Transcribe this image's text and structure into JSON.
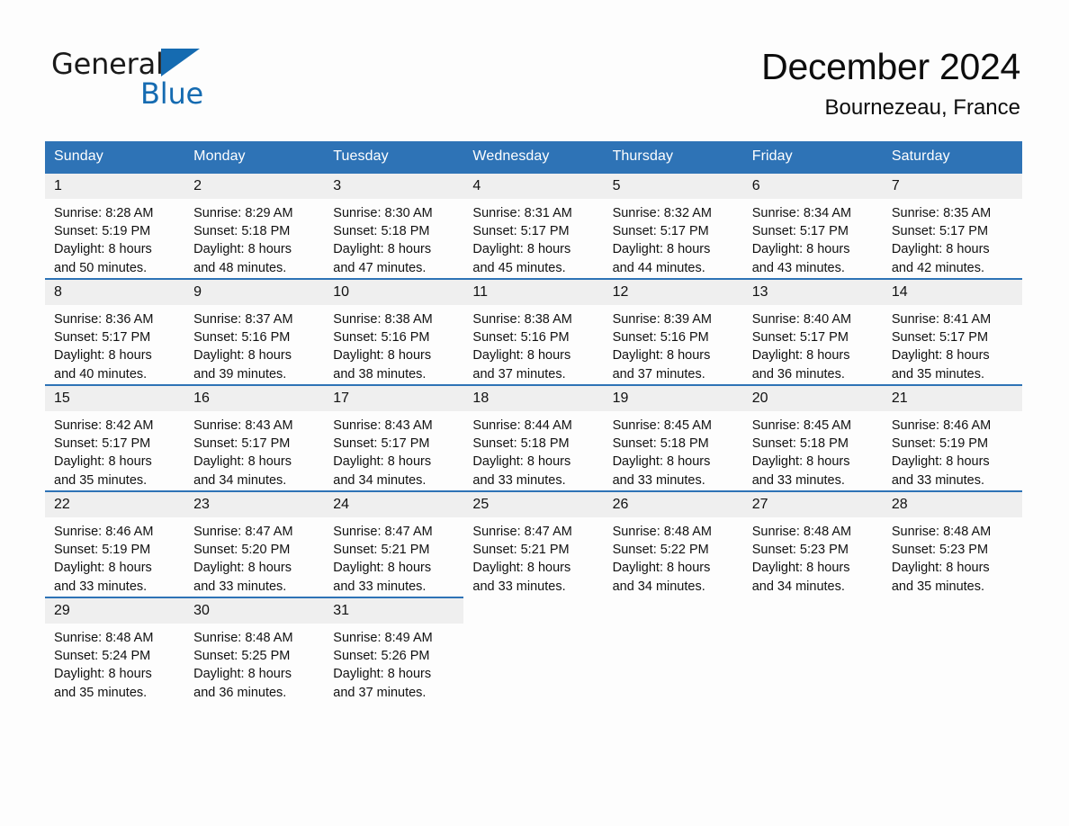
{
  "brand": {
    "name_part1": "General",
    "name_part2": "Blue",
    "accent_color": "#156bb1"
  },
  "header": {
    "title": "December 2024",
    "location": "Bournezeau, France"
  },
  "calendar": {
    "header_color": "#2e73b6",
    "weekday_headers": [
      "Sunday",
      "Monday",
      "Tuesday",
      "Wednesday",
      "Thursday",
      "Friday",
      "Saturday"
    ],
    "weeks": [
      [
        {
          "day": "1",
          "sunrise": "Sunrise: 8:28 AM",
          "sunset": "Sunset: 5:19 PM",
          "daylight1": "Daylight: 8 hours",
          "daylight2": "and 50 minutes."
        },
        {
          "day": "2",
          "sunrise": "Sunrise: 8:29 AM",
          "sunset": "Sunset: 5:18 PM",
          "daylight1": "Daylight: 8 hours",
          "daylight2": "and 48 minutes."
        },
        {
          "day": "3",
          "sunrise": "Sunrise: 8:30 AM",
          "sunset": "Sunset: 5:18 PM",
          "daylight1": "Daylight: 8 hours",
          "daylight2": "and 47 minutes."
        },
        {
          "day": "4",
          "sunrise": "Sunrise: 8:31 AM",
          "sunset": "Sunset: 5:17 PM",
          "daylight1": "Daylight: 8 hours",
          "daylight2": "and 45 minutes."
        },
        {
          "day": "5",
          "sunrise": "Sunrise: 8:32 AM",
          "sunset": "Sunset: 5:17 PM",
          "daylight1": "Daylight: 8 hours",
          "daylight2": "and 44 minutes."
        },
        {
          "day": "6",
          "sunrise": "Sunrise: 8:34 AM",
          "sunset": "Sunset: 5:17 PM",
          "daylight1": "Daylight: 8 hours",
          "daylight2": "and 43 minutes."
        },
        {
          "day": "7",
          "sunrise": "Sunrise: 8:35 AM",
          "sunset": "Sunset: 5:17 PM",
          "daylight1": "Daylight: 8 hours",
          "daylight2": "and 42 minutes."
        }
      ],
      [
        {
          "day": "8",
          "sunrise": "Sunrise: 8:36 AM",
          "sunset": "Sunset: 5:17 PM",
          "daylight1": "Daylight: 8 hours",
          "daylight2": "and 40 minutes."
        },
        {
          "day": "9",
          "sunrise": "Sunrise: 8:37 AM",
          "sunset": "Sunset: 5:16 PM",
          "daylight1": "Daylight: 8 hours",
          "daylight2": "and 39 minutes."
        },
        {
          "day": "10",
          "sunrise": "Sunrise: 8:38 AM",
          "sunset": "Sunset: 5:16 PM",
          "daylight1": "Daylight: 8 hours",
          "daylight2": "and 38 minutes."
        },
        {
          "day": "11",
          "sunrise": "Sunrise: 8:38 AM",
          "sunset": "Sunset: 5:16 PM",
          "daylight1": "Daylight: 8 hours",
          "daylight2": "and 37 minutes."
        },
        {
          "day": "12",
          "sunrise": "Sunrise: 8:39 AM",
          "sunset": "Sunset: 5:16 PM",
          "daylight1": "Daylight: 8 hours",
          "daylight2": "and 37 minutes."
        },
        {
          "day": "13",
          "sunrise": "Sunrise: 8:40 AM",
          "sunset": "Sunset: 5:17 PM",
          "daylight1": "Daylight: 8 hours",
          "daylight2": "and 36 minutes."
        },
        {
          "day": "14",
          "sunrise": "Sunrise: 8:41 AM",
          "sunset": "Sunset: 5:17 PM",
          "daylight1": "Daylight: 8 hours",
          "daylight2": "and 35 minutes."
        }
      ],
      [
        {
          "day": "15",
          "sunrise": "Sunrise: 8:42 AM",
          "sunset": "Sunset: 5:17 PM",
          "daylight1": "Daylight: 8 hours",
          "daylight2": "and 35 minutes."
        },
        {
          "day": "16",
          "sunrise": "Sunrise: 8:43 AM",
          "sunset": "Sunset: 5:17 PM",
          "daylight1": "Daylight: 8 hours",
          "daylight2": "and 34 minutes."
        },
        {
          "day": "17",
          "sunrise": "Sunrise: 8:43 AM",
          "sunset": "Sunset: 5:17 PM",
          "daylight1": "Daylight: 8 hours",
          "daylight2": "and 34 minutes."
        },
        {
          "day": "18",
          "sunrise": "Sunrise: 8:44 AM",
          "sunset": "Sunset: 5:18 PM",
          "daylight1": "Daylight: 8 hours",
          "daylight2": "and 33 minutes."
        },
        {
          "day": "19",
          "sunrise": "Sunrise: 8:45 AM",
          "sunset": "Sunset: 5:18 PM",
          "daylight1": "Daylight: 8 hours",
          "daylight2": "and 33 minutes."
        },
        {
          "day": "20",
          "sunrise": "Sunrise: 8:45 AM",
          "sunset": "Sunset: 5:18 PM",
          "daylight1": "Daylight: 8 hours",
          "daylight2": "and 33 minutes."
        },
        {
          "day": "21",
          "sunrise": "Sunrise: 8:46 AM",
          "sunset": "Sunset: 5:19 PM",
          "daylight1": "Daylight: 8 hours",
          "daylight2": "and 33 minutes."
        }
      ],
      [
        {
          "day": "22",
          "sunrise": "Sunrise: 8:46 AM",
          "sunset": "Sunset: 5:19 PM",
          "daylight1": "Daylight: 8 hours",
          "daylight2": "and 33 minutes."
        },
        {
          "day": "23",
          "sunrise": "Sunrise: 8:47 AM",
          "sunset": "Sunset: 5:20 PM",
          "daylight1": "Daylight: 8 hours",
          "daylight2": "and 33 minutes."
        },
        {
          "day": "24",
          "sunrise": "Sunrise: 8:47 AM",
          "sunset": "Sunset: 5:21 PM",
          "daylight1": "Daylight: 8 hours",
          "daylight2": "and 33 minutes."
        },
        {
          "day": "25",
          "sunrise": "Sunrise: 8:47 AM",
          "sunset": "Sunset: 5:21 PM",
          "daylight1": "Daylight: 8 hours",
          "daylight2": "and 33 minutes."
        },
        {
          "day": "26",
          "sunrise": "Sunrise: 8:48 AM",
          "sunset": "Sunset: 5:22 PM",
          "daylight1": "Daylight: 8 hours",
          "daylight2": "and 34 minutes."
        },
        {
          "day": "27",
          "sunrise": "Sunrise: 8:48 AM",
          "sunset": "Sunset: 5:23 PM",
          "daylight1": "Daylight: 8 hours",
          "daylight2": "and 34 minutes."
        },
        {
          "day": "28",
          "sunrise": "Sunrise: 8:48 AM",
          "sunset": "Sunset: 5:23 PM",
          "daylight1": "Daylight: 8 hours",
          "daylight2": "and 35 minutes."
        }
      ],
      [
        {
          "day": "29",
          "sunrise": "Sunrise: 8:48 AM",
          "sunset": "Sunset: 5:24 PM",
          "daylight1": "Daylight: 8 hours",
          "daylight2": "and 35 minutes."
        },
        {
          "day": "30",
          "sunrise": "Sunrise: 8:48 AM",
          "sunset": "Sunset: 5:25 PM",
          "daylight1": "Daylight: 8 hours",
          "daylight2": "and 36 minutes."
        },
        {
          "day": "31",
          "sunrise": "Sunrise: 8:49 AM",
          "sunset": "Sunset: 5:26 PM",
          "daylight1": "Daylight: 8 hours",
          "daylight2": "and 37 minutes."
        },
        {
          "day": "",
          "sunrise": "",
          "sunset": "",
          "daylight1": "",
          "daylight2": ""
        },
        {
          "day": "",
          "sunrise": "",
          "sunset": "",
          "daylight1": "",
          "daylight2": ""
        },
        {
          "day": "",
          "sunrise": "",
          "sunset": "",
          "daylight1": "",
          "daylight2": ""
        },
        {
          "day": "",
          "sunrise": "",
          "sunset": "",
          "daylight1": "",
          "daylight2": ""
        }
      ]
    ]
  }
}
